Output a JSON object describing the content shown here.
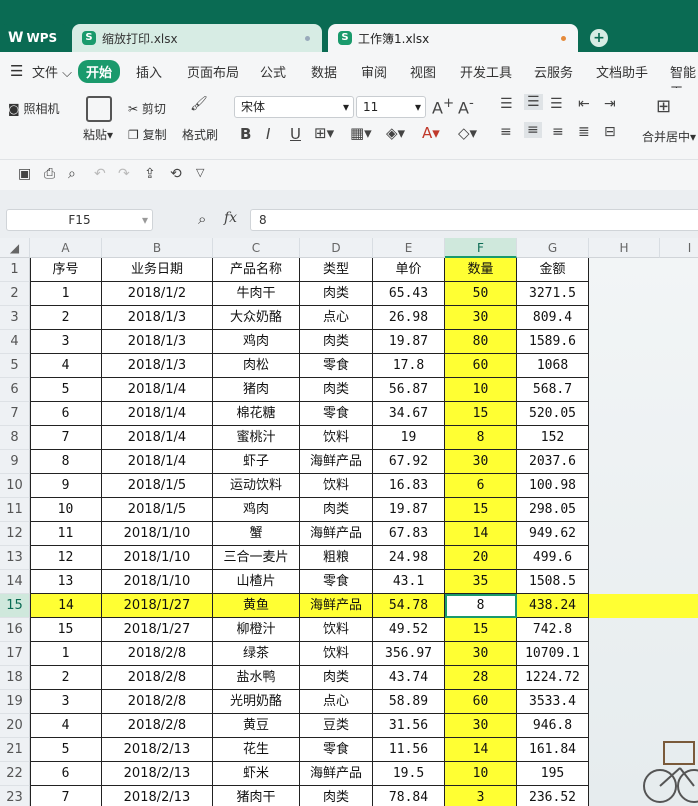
{
  "tabs": {
    "wps": "WPS",
    "file1": "缩放打印.xlsx",
    "file2": "工作簿1.xlsx",
    "file1_dot": "#9ab",
    "file2_dot": "#e58b3c"
  },
  "menu": {
    "file": "文件",
    "home": "开始",
    "insert": "插入",
    "layout": "页面布局",
    "formula": "公式",
    "data": "数据",
    "review": "审阅",
    "view": "视图",
    "dev": "开发工具",
    "cloud": "云服务",
    "doc": "文档助手",
    "smart": "智能工"
  },
  "ribbon": {
    "camera": "照相机",
    "paste": "粘贴",
    "cut": "剪切",
    "copy": "复制",
    "format_painter": "格式刷",
    "font": "宋体",
    "size": "11",
    "merge": "合并居中"
  },
  "formula": {
    "cell": "F15",
    "fx": "fx",
    "value": "8"
  },
  "columns": [
    "A",
    "B",
    "C",
    "D",
    "E",
    "F",
    "G",
    "H",
    "I"
  ],
  "rows": [
    [
      "1",
      "序号",
      "业务日期",
      "产品名称",
      "类型",
      "单价",
      "数量",
      "金额"
    ],
    [
      "2",
      "1",
      "2018/1/2",
      "牛肉干",
      "肉类",
      "65.43",
      "50",
      "3271.5"
    ],
    [
      "3",
      "2",
      "2018/1/3",
      "大众奶酪",
      "点心",
      "26.98",
      "30",
      "809.4"
    ],
    [
      "4",
      "3",
      "2018/1/3",
      "鸡肉",
      "肉类",
      "19.87",
      "80",
      "1589.6"
    ],
    [
      "5",
      "4",
      "2018/1/3",
      "肉松",
      "零食",
      "17.8",
      "60",
      "1068"
    ],
    [
      "6",
      "5",
      "2018/1/4",
      "猪肉",
      "肉类",
      "56.87",
      "10",
      "568.7"
    ],
    [
      "7",
      "6",
      "2018/1/4",
      "棉花糖",
      "零食",
      "34.67",
      "15",
      "520.05"
    ],
    [
      "8",
      "7",
      "2018/1/4",
      "蜜桃汁",
      "饮料",
      "19",
      "8",
      "152"
    ],
    [
      "9",
      "8",
      "2018/1/4",
      "虾子",
      "海鲜产品",
      "67.92",
      "30",
      "2037.6"
    ],
    [
      "10",
      "9",
      "2018/1/5",
      "运动饮料",
      "饮料",
      "16.83",
      "6",
      "100.98"
    ],
    [
      "11",
      "10",
      "2018/1/5",
      "鸡肉",
      "肉类",
      "19.87",
      "15",
      "298.05"
    ],
    [
      "12",
      "11",
      "2018/1/10",
      "蟹",
      "海鲜产品",
      "67.83",
      "14",
      "949.62"
    ],
    [
      "13",
      "12",
      "2018/1/10",
      "三合一麦片",
      "粗粮",
      "24.98",
      "20",
      "499.6"
    ],
    [
      "14",
      "13",
      "2018/1/10",
      "山楂片",
      "零食",
      "43.1",
      "35",
      "1508.5"
    ],
    [
      "15",
      "14",
      "2018/1/27",
      "黄鱼",
      "海鲜产品",
      "54.78",
      "8",
      "438.24"
    ],
    [
      "16",
      "15",
      "2018/1/27",
      "柳橙汁",
      "饮料",
      "49.52",
      "15",
      "742.8"
    ],
    [
      "17",
      "1",
      "2018/2/8",
      "绿茶",
      "饮料",
      "356.97",
      "30",
      "10709.1"
    ],
    [
      "18",
      "2",
      "2018/2/8",
      "盐水鸭",
      "肉类",
      "43.74",
      "28",
      "1224.72"
    ],
    [
      "19",
      "3",
      "2018/2/8",
      "光明奶酪",
      "点心",
      "58.89",
      "60",
      "3533.4"
    ],
    [
      "20",
      "4",
      "2018/2/8",
      "黄豆",
      "豆类",
      "31.56",
      "30",
      "946.8"
    ],
    [
      "21",
      "5",
      "2018/2/13",
      "花生",
      "零食",
      "11.56",
      "14",
      "161.84"
    ],
    [
      "22",
      "6",
      "2018/2/13",
      "虾米",
      "海鲜产品",
      "19.5",
      "10",
      "195"
    ],
    [
      "23",
      "7",
      "2018/2/13",
      "猪肉干",
      "肉类",
      "78.84",
      "3",
      "236.52"
    ]
  ],
  "colors": {
    "highlight": "#ffff33",
    "accent": "#1a9a6c"
  }
}
